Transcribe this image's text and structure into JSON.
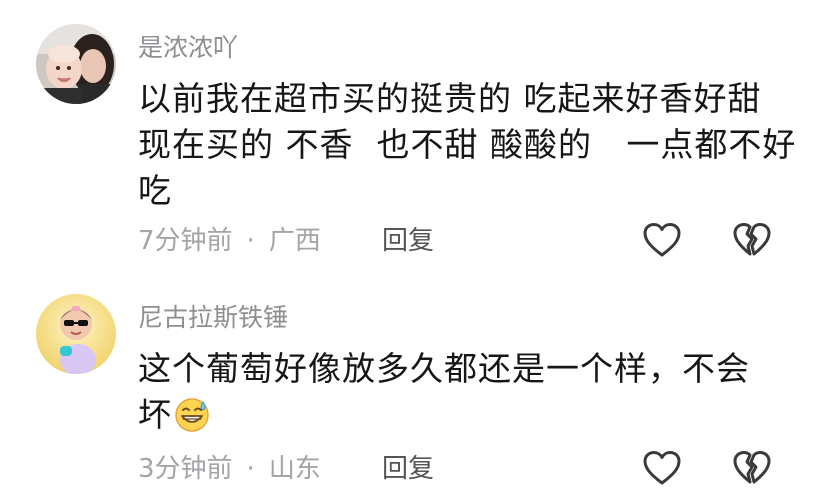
{
  "comments": [
    {
      "username": "是浓浓吖",
      "lines": [
        "以前我在超市买的挺贵的 吃起来好香好甜",
        "现在买的 不香  也不甜 酸酸的   一点都不好",
        "吃"
      ],
      "time": "7分钟前",
      "separator": "·",
      "location": "广西",
      "reply_label": "回复",
      "like_icon": "heart-outline-icon",
      "dislike_icon": "broken-heart-icon"
    },
    {
      "username": "尼古拉斯铁锤",
      "lines": [
        "这个葡萄好像放多久都还是一个样，不会",
        "坏"
      ],
      "emoji": "grinning-sweat-emoji",
      "time": "3分钟前",
      "separator": "·",
      "location": "山东",
      "reply_label": "回复",
      "like_icon": "heart-outline-icon",
      "dislike_icon": "broken-heart-icon"
    }
  ],
  "colors": {
    "username": "#8e8e93",
    "content": "#161616",
    "meta": "#a3a3a8",
    "reply": "#555555",
    "icon_stroke": "#3a3a3a"
  }
}
